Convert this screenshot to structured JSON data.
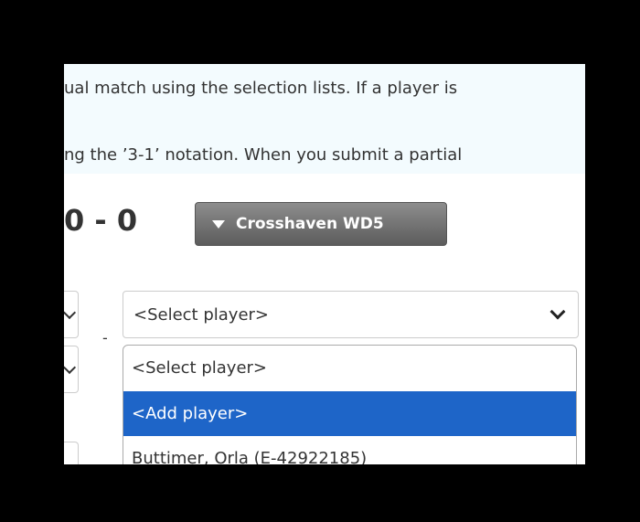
{
  "instructions": {
    "line1": "ual match using the selection lists. If a player is",
    "line2": "ng the ’3-1’ notation. When you submit a partial"
  },
  "match": {
    "score": "0 - 0",
    "team_button_label": "Crosshaven WD5"
  },
  "player_select": {
    "value": "<Select player>",
    "options": [
      "<Select player>",
      "<Add player>",
      "Buttimer, Orla (E-42922185)"
    ],
    "highlighted": "<Add player>"
  },
  "separator": "-",
  "colors": {
    "highlight": "#1e65c8",
    "info_band": "#f3fbfe",
    "button": "#6f6f6f"
  },
  "icons": [
    "caret-down-icon",
    "chevron-down-icon"
  ]
}
